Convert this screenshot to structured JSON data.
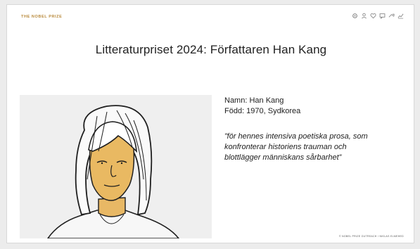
{
  "brand": "THE NOBEL PRIZE",
  "toolbar": {
    "icons": [
      "settings-icon",
      "user-icon",
      "heart-icon",
      "chat-icon",
      "share-icon",
      "chart-icon"
    ]
  },
  "slide": {
    "title": "Litteraturpriset 2024: Författaren Han Kang",
    "name_line": "Namn: Han Kang",
    "born_line": "Född: 1970, Sydkorea",
    "quote_lines": [
      "”för hennes intensiva poetiska prosa, som",
      "konfronterar historiens trauman och",
      "blottlägger människans sårbarhet”"
    ],
    "credit": "© NOBEL PRIZE OUTREACH / NIKLAS ELMEHED"
  },
  "colors": {
    "brand_gold": "#b8893a",
    "portrait_bg": "#efefef",
    "gold_accent": "#e2b45a",
    "ink": "#1f1f1f"
  }
}
